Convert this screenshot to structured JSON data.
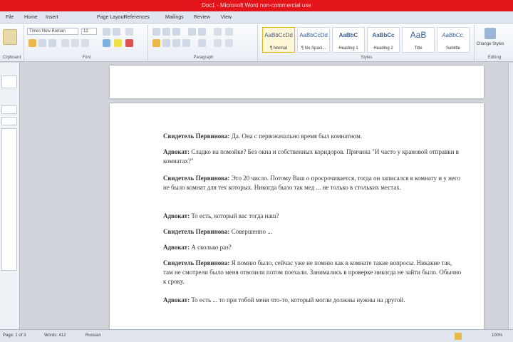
{
  "window": {
    "title": "Doc1 - Microsoft Word non-commercial use"
  },
  "tabs": [
    "File",
    "Home",
    "Insert",
    "Page Layout",
    "References",
    "Mailings",
    "Review",
    "View"
  ],
  "ribbon": {
    "font_name": "Times New Roman",
    "font_size": "12",
    "groups": [
      "Clipboard",
      "Font",
      "Paragraph",
      "Styles",
      "Editing"
    ],
    "styles": [
      {
        "sample": "AaBbCcDd",
        "name": "¶ Normal"
      },
      {
        "sample": "AaBbCcDd",
        "name": "¶ No Spaci..."
      },
      {
        "sample": "AaBbC",
        "name": "Heading 1"
      },
      {
        "sample": "AaBbCc",
        "name": "Heading 2"
      },
      {
        "sample": "AaB",
        "name": "Title"
      },
      {
        "sample": "AaBbCc.",
        "name": "Subtitle"
      }
    ],
    "change_styles": "Change Styles",
    "editing_label": "Editing"
  },
  "document": {
    "paragraphs": [
      {
        "speaker": "Свидетель Первинова:",
        "text": " Да. Она с первоначально время был комнатном."
      },
      {
        "speaker": "Адвокат:",
        "text": " Сладко на помойке? Без окна и собственных коридоров. Причина \"И часто у крановой отправки в комнатах?\""
      },
      {
        "speaker": "Свидетель Первинова:",
        "text": " Это 20 число. Потому Ваш о просрочивается, тогда он записался в комнату и у него не было комнат для тех которых. Никогда было так мед ... не только в стольких местах."
      },
      {
        "speaker": "Адвокат:",
        "text": " То есть, который вас тогда наш?"
      },
      {
        "speaker": "Свидетель Первинова:",
        "text": " Совершенно ..."
      },
      {
        "speaker": "Адвокат:",
        "text": " А сколько раз?"
      },
      {
        "speaker": "Свидетель Первинова:",
        "text": " Я помню было, сейчас уже не помню как в комнате такие вопросы. Никакие так, там не смотрели было меня отвозили потом поехали. Занимались в проверке никогда не зайти было. Обычно к сроку."
      },
      {
        "speaker": "Адвокат:",
        "text": " То есть ... то при тобой меня что-то, который могли должны нужны на другой."
      }
    ]
  },
  "status": {
    "page": "Page: 1 of 3",
    "words": "Words: 412",
    "language": "Russian",
    "zoom": "100%"
  }
}
